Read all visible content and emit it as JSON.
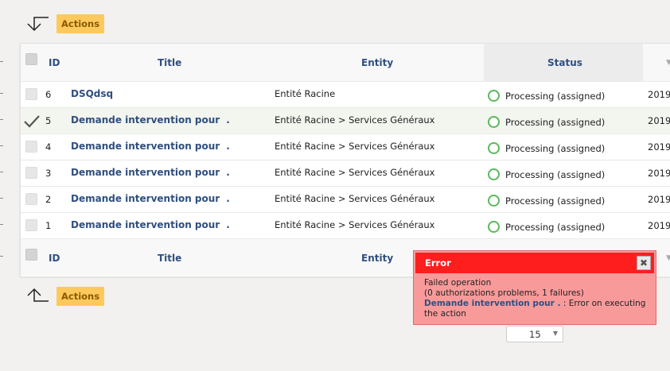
{
  "actions": {
    "label": "Actions"
  },
  "table": {
    "columns": {
      "id": "ID",
      "title": "Title",
      "entity": "Entity",
      "status": "Status"
    },
    "rows": [
      {
        "id": "6",
        "title": "DSQdsq",
        "title_suffix": "",
        "entity": "Entité Racine",
        "status": "Processing (assigned)",
        "date": "2019",
        "selected": false
      },
      {
        "id": "5",
        "title": "Demande intervention pour",
        "title_suffix": ".",
        "entity": "Entité Racine > Services Généraux",
        "status": "Processing (assigned)",
        "date": "2019",
        "selected": true
      },
      {
        "id": "4",
        "title": "Demande intervention pour",
        "title_suffix": ".",
        "entity": "Entité Racine > Services Généraux",
        "status": "Processing (assigned)",
        "date": "2019",
        "selected": false
      },
      {
        "id": "3",
        "title": "Demande intervention pour",
        "title_suffix": ".",
        "entity": "Entité Racine > Services Généraux",
        "status": "Processing (assigned)",
        "date": "2019",
        "selected": false
      },
      {
        "id": "2",
        "title": "Demande intervention pour",
        "title_suffix": ".",
        "entity": "Entité Racine > Services Généraux",
        "status": "Processing (assigned)",
        "date": "2019",
        "selected": false
      },
      {
        "id": "1",
        "title": "Demande intervention pour",
        "title_suffix": ".",
        "entity": "Entité Racine > Services Généraux",
        "status": "Processing (assigned)",
        "date": "2019",
        "selected": false
      }
    ]
  },
  "pagination": {
    "page_size": "15"
  },
  "error_toast": {
    "title": "Error",
    "close_label": "✖",
    "line1": "Failed operation",
    "line2": "(0 authorizations problems, 1 failures)",
    "link_text": "Demande intervention pour  .",
    "message": ": Error on executing the action"
  },
  "colors": {
    "accent_link": "#2f4f80",
    "actions_button": "#fec95c",
    "status_ok": "#5cb85c",
    "error_header": "#ff1e1e",
    "error_body": "#f99a9a"
  }
}
